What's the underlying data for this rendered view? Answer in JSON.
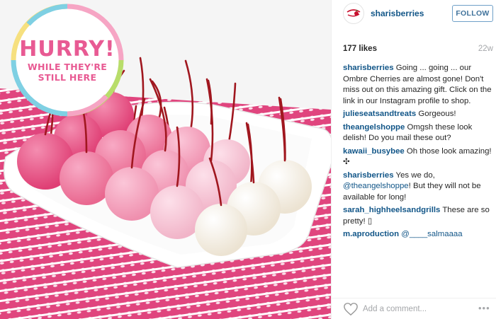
{
  "post": {
    "username": "sharisberries",
    "avatar_alt": "Shari's Berries",
    "follow_label": "FOLLOW",
    "likes": "177 likes",
    "time": "22w"
  },
  "image": {
    "badge_title": "HURRY!",
    "badge_line1": "WHILE THEY'RE",
    "badge_line2": "STILL HERE"
  },
  "comments": [
    {
      "user": "sharisberries",
      "mention": "",
      "text": "Going ... going ... our Ombre Cherries are almost gone! Don't miss out on this amazing gift. Click on the link in our Instagram profile to shop."
    },
    {
      "user": "julieseatsandtreats",
      "mention": "",
      "text": "Gorgeous!"
    },
    {
      "user": "theangelshoppe",
      "mention": "",
      "text": "Omgsh these look delish! Do you mail these out?"
    },
    {
      "user": "kawaii_busybee",
      "mention": "",
      "text": "Oh those look amazing! ✣"
    },
    {
      "user": "sharisberries",
      "mention": "@theangelshoppe",
      "text": "! But they will not be available for long!",
      "prefix": "Yes we do,"
    },
    {
      "user": "sarah_highheelsandgrills",
      "mention": "",
      "text": "These are so pretty! ▯"
    },
    {
      "user": "m.aproduction",
      "mention": "@____salmaaaa",
      "text": ""
    }
  ],
  "footer": {
    "comment_placeholder": "Add a comment...",
    "more_label": "•••"
  },
  "colors": {
    "link": "#125688",
    "follow_border": "#6fa0c8",
    "muted": "#a5a7aa",
    "badge_pink": "#e85a93"
  }
}
